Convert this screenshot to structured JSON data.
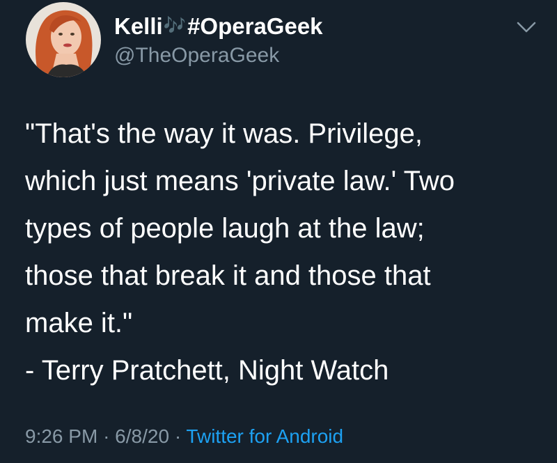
{
  "tweet": {
    "author": {
      "name": "Kelli",
      "name_emoji": "🎶",
      "name_suffix": "#OperaGeek",
      "handle": "@TheOperaGeek"
    },
    "text_lines": [
      "\"That's the way it was. Privilege,",
      "which just means 'private law.' Two",
      "types of people laugh at the law;",
      "those that break it and those that",
      "make it.\"",
      "- Terry Pratchett, Night Watch"
    ],
    "meta": {
      "time": "9:26 PM",
      "separator": "·",
      "date": "6/8/20",
      "source": "Twitter for Android"
    }
  },
  "colors": {
    "background": "#15202b",
    "text_primary": "#ffffff",
    "text_secondary": "#8899a6",
    "accent": "#1da1f2"
  },
  "icons": {
    "caret": "chevron-down-icon",
    "emoji": "musical-notes-icon"
  }
}
